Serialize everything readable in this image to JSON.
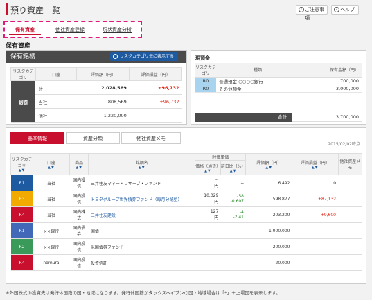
{
  "header": {
    "title": "預り資産一覧",
    "notes_button": "ご注意事項",
    "help_button": "ヘルプ",
    "notes_icon": "exclamation-icon",
    "help_icon": "question-icon"
  },
  "main_tabs": [
    {
      "label": "保有資産",
      "active": true
    },
    {
      "label": "他社資産登録",
      "active": false
    },
    {
      "label": "現状資産分析",
      "active": false
    }
  ],
  "section_title": "保有資産",
  "holdings_summary": {
    "header": "保有銘柄",
    "risk_button": "リスクカテゴリ毎に表示する",
    "risk_button_icon": "search-icon",
    "columns": [
      "リスクカテゴリ",
      "口座",
      "評価額（円）",
      "評価損益（円）"
    ],
    "group_label": "総額",
    "rows": [
      {
        "account": "計",
        "value": "2,028,569",
        "pl": "+96,732"
      },
      {
        "account": "当社",
        "value": "808,569",
        "pl": "+96,732"
      },
      {
        "account": "他社",
        "value": "1,220,000",
        "pl": "--"
      }
    ]
  },
  "deposits": {
    "title": "現預金",
    "columns": [
      "リスクカテゴリ",
      "種類",
      "保有金額（円）"
    ],
    "rows": [
      {
        "code": "R0",
        "type": "普通預金 ○○○○銀行",
        "amount": "700,000"
      },
      {
        "code": "R0",
        "type": "その他預金",
        "amount": "3,000,000"
      }
    ],
    "total_label": "合計",
    "total_value": "3,700,000"
  },
  "sub_tabs": [
    {
      "label": "基本情報",
      "active": true
    },
    {
      "label": "資産分類",
      "active": false
    },
    {
      "label": "他社資産メモ",
      "active": false
    }
  ],
  "as_of": "2015/02/02時点",
  "holdings_table": {
    "columns": {
      "risk": "リスクカテゴリ",
      "account": "口座",
      "product": "商品",
      "name": "銘柄名",
      "market_group": "时価単価",
      "price": "価格（通貨）",
      "change": "前日比（%）",
      "value": "評価額（円）",
      "pl": "評価損益（円）",
      "other": "他社資産メモ"
    },
    "sort_arrows": "▲▼",
    "rows": [
      {
        "risk": "R1",
        "risk_color": "#1e5aa0",
        "account": "当社",
        "product": "国内投信",
        "name": "三井住友マネー・リザーブ・ファンド",
        "link": false,
        "price": "--",
        "price_unit": "円",
        "change1": "--",
        "change2": "",
        "change_color": "",
        "value": "6,492",
        "pl": "0",
        "pl_color": ""
      },
      {
        "risk": "R3",
        "risk_color": "#f2a900",
        "account": "当社",
        "product": "国内投信",
        "name": "トヨタグループ世界債券ファンド（毎月分配型）",
        "link": true,
        "price": "10,029",
        "price_unit": "円",
        "change1": "-58",
        "change2": "-0.607",
        "change_color": "green",
        "value": "598,877",
        "pl": "+87,132",
        "pl_color": "red"
      },
      {
        "risk": "R4",
        "risk_color": "#c8102e",
        "account": "当社",
        "product": "国内株式",
        "name": "三井住友建設",
        "link": true,
        "price": "127",
        "price_unit": "円",
        "change1": "-4",
        "change2": "-2.41",
        "change_color": "green",
        "value": "203,200",
        "pl": "+9,600",
        "pl_color": "red"
      },
      {
        "risk": "R1",
        "risk_color": "#4169b8",
        "account": "××銀行",
        "product": "国内債券",
        "name": "国債",
        "link": false,
        "price": "--",
        "price_unit": "",
        "change1": "--",
        "change2": "",
        "change_color": "",
        "value": "1,000,000",
        "pl": "--",
        "pl_color": ""
      },
      {
        "risk": "R2",
        "risk_color": "#3a9a5a",
        "account": "××銀行",
        "product": "国内投信",
        "name": "米国債券ファンド",
        "link": false,
        "price": "--",
        "price_unit": "",
        "change1": "--",
        "change2": "",
        "change_color": "",
        "value": "200,000",
        "pl": "--",
        "pl_color": ""
      },
      {
        "risk": "R4",
        "risk_color": "#c8102e",
        "account": "nomura",
        "product": "国内投信",
        "name": "投資信託",
        "link": false,
        "price": "--",
        "price_unit": "",
        "change1": "--",
        "change2": "",
        "change_color": "",
        "value": "20,000",
        "pl": "--",
        "pl_color": ""
      }
    ]
  },
  "footnote": "※外国株式の投資先は発行体国籍の国・地域になります。発行体国籍がタックスヘイブンの国・地域場合は「*」＋上場国を表示します。"
}
